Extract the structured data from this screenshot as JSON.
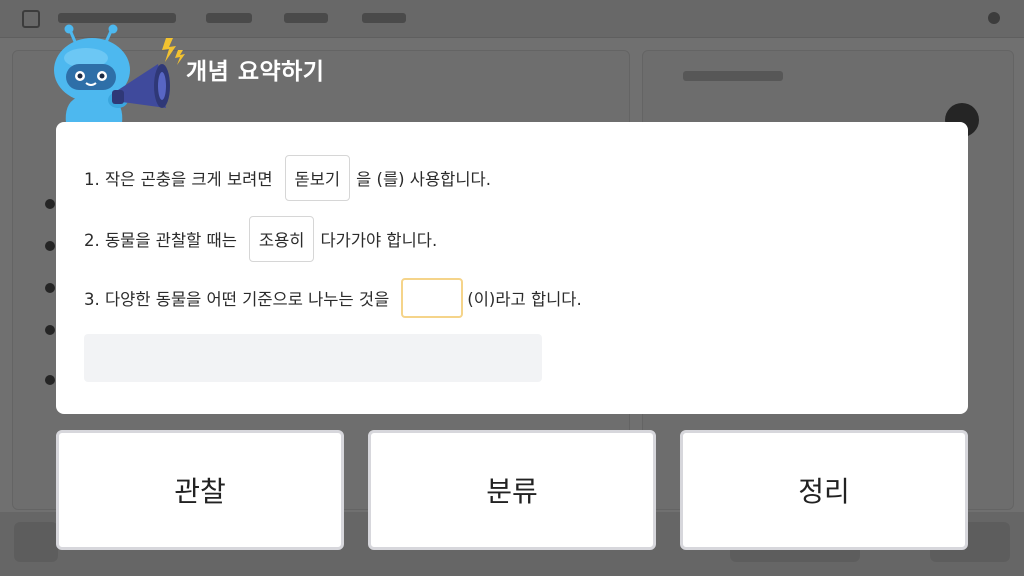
{
  "header": {
    "title": "개념 요약하기"
  },
  "summary": {
    "sentences": [
      {
        "prefix": "1. 작은 곤충을 크게 보려면",
        "answer": "돋보기",
        "suffix": "을 (를) 사용합니다."
      },
      {
        "prefix": "2. 동물을 관찰할 때는",
        "answer": "조용히",
        "suffix": "다가가야 합니다."
      },
      {
        "prefix": "3. 다양한 동물을 어떤 기준으로 나누는 것을",
        "answer": "",
        "suffix": "(이)라고 합니다."
      }
    ]
  },
  "choices": [
    {
      "label": "관찰"
    },
    {
      "label": "분류"
    },
    {
      "label": "정리"
    }
  ],
  "colors": {
    "overlay": "#000000",
    "blank_border": "#f5d48a",
    "mascot_body": "#4db8ef",
    "megaphone": "#3f4a9c",
    "lightning": "#f2c230"
  },
  "icons": [
    "mascot-icon",
    "megaphone-icon",
    "lightning-icon"
  ]
}
